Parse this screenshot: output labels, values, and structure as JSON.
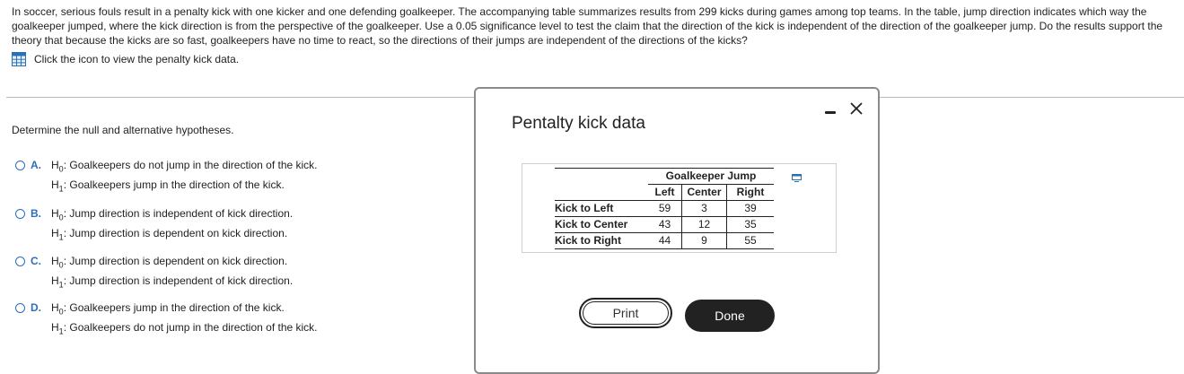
{
  "intro": {
    "text": "In soccer, serious fouls result in a penalty kick with one kicker and one defending goalkeeper. The accompanying table summarizes results from 299 kicks during games among top teams. In the table, jump direction indicates which way the goalkeeper jumped, where the kick direction is from the perspective of the goalkeeper. Use a 0.05 significance level to test the claim that the direction of the kick is independent of the direction of the goalkeeper jump. Do the results support the theory that because the kicks are so fast, goalkeepers have no time to react, so the directions of their jumps are independent of the directions of the kicks?",
    "data_link": "Click the icon to view the penalty kick data."
  },
  "question": "Determine the null and alternative hypotheses.",
  "choices": [
    {
      "letter": "A.",
      "h0": ": Goalkeepers do not jump in the direction of the kick.",
      "h1": ": Goalkeepers jump in the direction of the kick."
    },
    {
      "letter": "B.",
      "h0": ": Jump direction is independent of kick direction.",
      "h1": ": Jump direction is dependent on kick direction."
    },
    {
      "letter": "C.",
      "h0": ": Jump direction is dependent on kick direction.",
      "h1": ": Jump direction is independent of kick direction."
    },
    {
      "letter": "D.",
      "h0": ": Goalkeepers jump in the direction of the kick.",
      "h1": ": Goalkeepers do not jump in the direction of the kick."
    }
  ],
  "modal": {
    "title": "Pentalty kick data",
    "table": {
      "group_header": "Goalkeeper Jump",
      "columns": [
        "Left",
        "Center",
        "Right"
      ],
      "rows": [
        {
          "label": "Kick to Left",
          "values": [
            "59",
            "3",
            "39"
          ]
        },
        {
          "label": "Kick to Center",
          "values": [
            "43",
            "12",
            "35"
          ]
        },
        {
          "label": "Kick to Right",
          "values": [
            "44",
            "9",
            "55"
          ]
        }
      ]
    },
    "print_label": "Print",
    "done_label": "Done"
  },
  "colors": {
    "accent": "#2a6fb8",
    "text": "#222222",
    "done_bg": "#222222"
  }
}
